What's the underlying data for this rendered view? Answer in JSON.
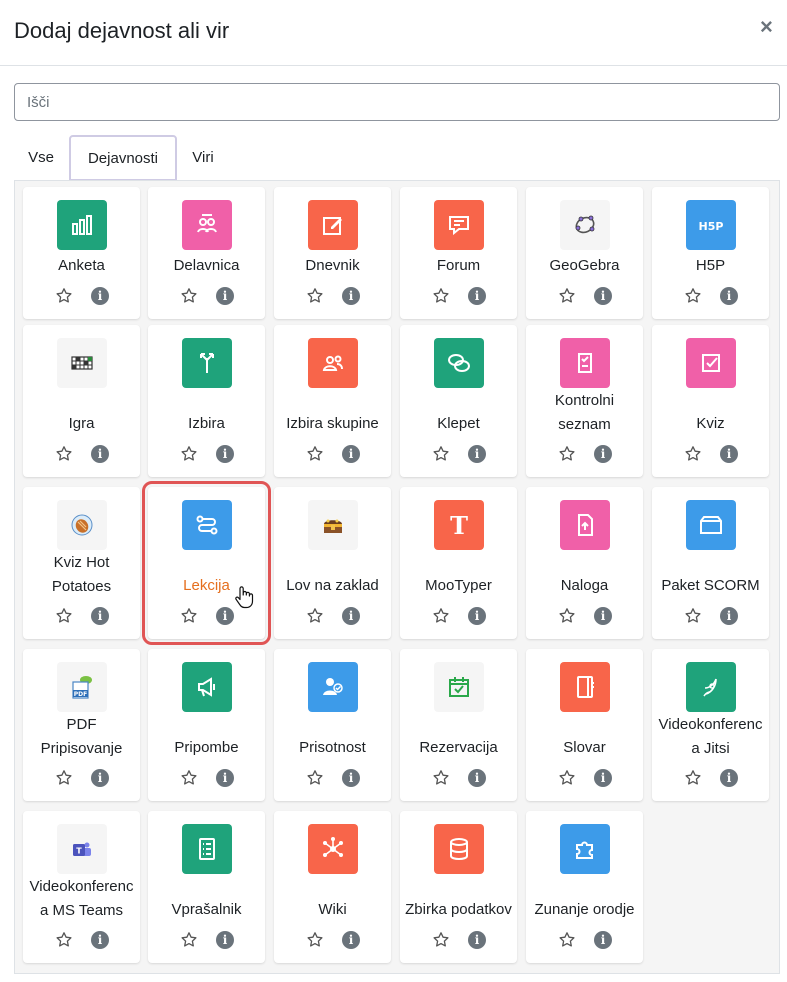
{
  "dialog": {
    "title": "Dodaj dejavnost ali vir",
    "close_label": "×"
  },
  "search": {
    "placeholder": "Išči",
    "value": ""
  },
  "tabs": [
    {
      "label": "Vse",
      "active": false
    },
    {
      "label": "Dejavnosti",
      "active": true
    },
    {
      "label": "Viri",
      "active": false
    }
  ],
  "colors": {
    "green": "#1fa37b",
    "pink": "#f060a8",
    "orange": "#f8654a",
    "blue": "#3d9be9",
    "highlight": "#e05555",
    "hover_text": "#e56f1e"
  },
  "activities": [
    {
      "label": "Anketa",
      "icon": "bar-chart-icon",
      "color": "green"
    },
    {
      "label": "Delavnica",
      "icon": "workshop-icon",
      "color": "pink"
    },
    {
      "label": "Dnevnik",
      "icon": "edit-note-icon",
      "color": "orange"
    },
    {
      "label": "Forum",
      "icon": "forum-icon",
      "color": "orange"
    },
    {
      "label": "GeoGebra",
      "icon": "geogebra-icon",
      "color": "plain"
    },
    {
      "label": "H5P",
      "icon": "h5p-icon",
      "color": "blue"
    },
    {
      "label": "Igra",
      "icon": "crossword-game-icon",
      "color": "plain"
    },
    {
      "label": "Izbira",
      "icon": "signpost-icon",
      "color": "green"
    },
    {
      "label": "Izbira skupine",
      "icon": "group-choice-icon",
      "color": "orange"
    },
    {
      "label": "Klepet",
      "icon": "chat-icon",
      "color": "green"
    },
    {
      "label": "Kontrolni seznam",
      "icon": "checklist-icon",
      "color": "pink"
    },
    {
      "label": "Kviz",
      "icon": "quiz-checkbox-icon",
      "color": "pink"
    },
    {
      "label": "Kviz Hot Potatoes",
      "icon": "hot-potatoes-icon",
      "color": "plain"
    },
    {
      "label": "Lekcija",
      "icon": "lesson-path-icon",
      "color": "blue"
    },
    {
      "label": "Lov na zaklad",
      "icon": "treasure-chest-icon",
      "color": "plain"
    },
    {
      "label": "MooTyper",
      "icon": "mootyper-t-icon",
      "color": "orange"
    },
    {
      "label": "Naloga",
      "icon": "assignment-upload-icon",
      "color": "pink"
    },
    {
      "label": "Paket SCORM",
      "icon": "scorm-package-icon",
      "color": "blue"
    },
    {
      "label": "PDF Pripisovanje",
      "icon": "pdf-annotation-icon",
      "color": "plain"
    },
    {
      "label": "Pripombe",
      "icon": "megaphone-icon",
      "color": "green"
    },
    {
      "label": "Prisotnost",
      "icon": "attendance-icon",
      "color": "blue"
    },
    {
      "label": "Rezervacija",
      "icon": "calendar-check-icon",
      "color": "plain"
    },
    {
      "label": "Slovar",
      "icon": "glossary-book-icon",
      "color": "orange"
    },
    {
      "label": "Videokonferenca Jitsi",
      "icon": "jitsi-icon",
      "color": "green"
    },
    {
      "label": "Videokonferenca MS Teams",
      "icon": "teams-icon",
      "color": "plain"
    },
    {
      "label": "Vprašalnik",
      "icon": "questionnaire-list-icon",
      "color": "green"
    },
    {
      "label": "Wiki",
      "icon": "wiki-network-icon",
      "color": "orange"
    },
    {
      "label": "Zbirka podatkov",
      "icon": "database-icon",
      "color": "orange"
    },
    {
      "label": "Zunanje orodje",
      "icon": "puzzle-icon",
      "color": "blue"
    }
  ],
  "label_lines": {
    "10": [
      "Kontrolni",
      "seznam"
    ],
    "12": [
      "Kviz Hot",
      "Potatoes"
    ],
    "18": [
      "PDF",
      "Pripisovanje"
    ],
    "23": [
      "Videokonferenc",
      "a Jitsi"
    ],
    "24": [
      "Videokonferenc",
      "a MS Teams"
    ]
  },
  "highlighted_index": 13,
  "info_glyph": "i"
}
